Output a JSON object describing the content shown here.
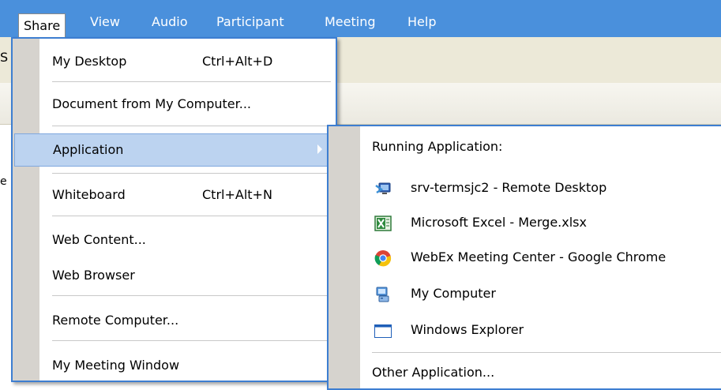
{
  "menubar": {
    "items": [
      {
        "label": "Share",
        "mnemonic_index": 0
      },
      {
        "label": "View",
        "mnemonic_index": 0
      },
      {
        "label": "Audio",
        "mnemonic_index": 0
      },
      {
        "label": "Participant",
        "mnemonic_index": 0
      },
      {
        "label": "Meeting",
        "mnemonic_index": 0
      },
      {
        "label": "Help",
        "mnemonic_index": 0
      }
    ]
  },
  "background": {
    "edge_char_1": "S",
    "edge_char_2": "e"
  },
  "share_menu": {
    "items": [
      {
        "label": "My Desktop",
        "shortcut": "Ctrl+Alt+D"
      },
      {
        "label": "Document from My Computer..."
      },
      {
        "label": "Application"
      },
      {
        "label": "Whiteboard",
        "shortcut": "Ctrl+Alt+N"
      },
      {
        "label": "Web Content..."
      },
      {
        "label": "Web Browser"
      },
      {
        "label": "Remote Computer..."
      },
      {
        "label": "My Meeting Window"
      }
    ]
  },
  "app_submenu": {
    "header": "Running Application:",
    "apps": [
      {
        "label": "srv-termsjc2 - Remote Desktop",
        "icon": "remote-desktop-icon"
      },
      {
        "label": "Microsoft Excel - Merge.xlsx",
        "icon": "excel-icon"
      },
      {
        "label": "WebEx Meeting Center - Google Chrome",
        "icon": "chrome-icon"
      },
      {
        "label": "My Computer",
        "icon": "my-computer-icon"
      },
      {
        "label": "Windows Explorer",
        "icon": "window-icon"
      }
    ],
    "other": "Other Application..."
  },
  "colors": {
    "menubar_bg": "#4a90dc",
    "menu_border": "#3d7ed1",
    "highlight_bg": "#bcd3f0",
    "gutter": "#d6d3ce"
  }
}
